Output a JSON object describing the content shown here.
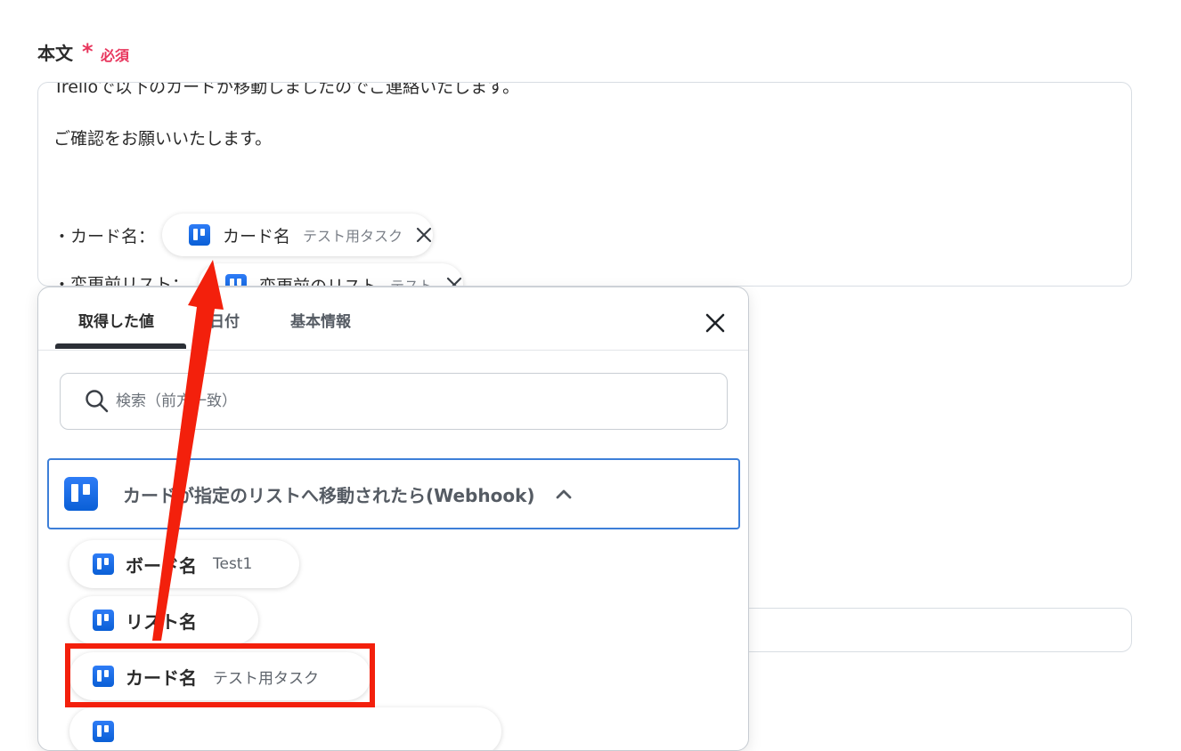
{
  "field": {
    "label": "本文",
    "required_star": "*",
    "required_text": "必須"
  },
  "body_text": {
    "line1": "Trelloで以下のカードが移動しましたのでご連絡いたします。",
    "line2": "ご確認をお願いいたします。",
    "line3_prefix": "・カード名：",
    "line4_prefix": "・変更前リスト："
  },
  "inline_chips": [
    {
      "name": "カード名",
      "value": "テスト用タスク"
    },
    {
      "name": "変更前のリスト",
      "value": "テスト"
    }
  ],
  "panel": {
    "tabs": [
      {
        "label": "取得した値",
        "active": true
      },
      {
        "label": "日付",
        "active": false
      },
      {
        "label": "基本情報",
        "active": false
      }
    ],
    "search_placeholder": "検索（前方一致）",
    "group_title": "カードが指定のリストへ移動されたら(Webhook)",
    "items": [
      {
        "name": "ボード名",
        "value": "Test1"
      },
      {
        "name": "リスト名",
        "value": ""
      },
      {
        "name": "カード名",
        "value": "テスト用タスク"
      },
      {
        "name": "",
        "value": ""
      }
    ]
  },
  "colors": {
    "required": "#e8365d",
    "annotation_red": "#f3200c",
    "trello_blue": "#1868db",
    "group_border": "#3d7fd8"
  },
  "icons": [
    "trello-icon",
    "close-icon",
    "search-icon",
    "chevron-up-icon"
  ]
}
